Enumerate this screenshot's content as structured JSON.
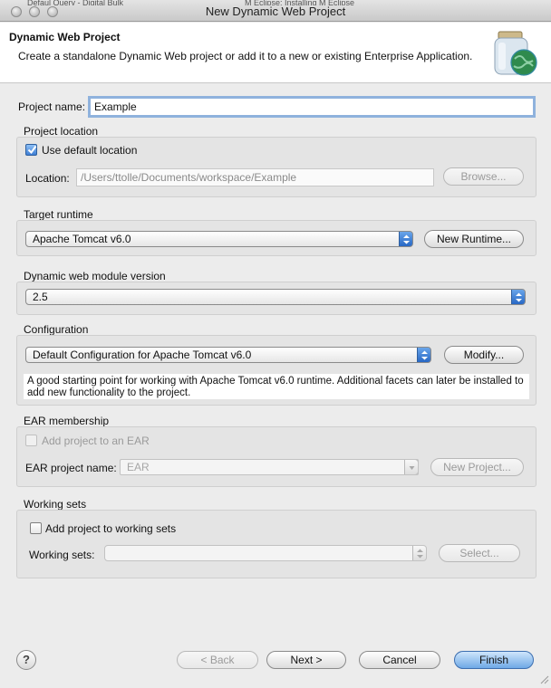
{
  "background_tabs": [
    "Defaul Query - Digital Bulk",
    "M Eclipse: Installing M Eclipse"
  ],
  "window": {
    "title": "New Dynamic Web Project"
  },
  "header": {
    "title": "Dynamic Web Project",
    "description": "Create a standalone Dynamic Web project or add it to a new or existing Enterprise Application.",
    "icon": "web-project-jar-globe-icon"
  },
  "project_name": {
    "label": "Project name:",
    "value": "Example"
  },
  "project_location": {
    "group_label": "Project location",
    "use_default_label": "Use default location",
    "use_default_checked": true,
    "location_label": "Location:",
    "location_value": "/Users/ttolle/Documents/workspace/Example",
    "browse_label": "Browse..."
  },
  "target_runtime": {
    "group_label": "Target runtime",
    "selected": "Apache Tomcat v6.0",
    "new_runtime_label": "New Runtime..."
  },
  "module_version": {
    "group_label": "Dynamic web module version",
    "selected": "2.5"
  },
  "configuration": {
    "group_label": "Configuration",
    "selected": "Default Configuration for Apache Tomcat v6.0",
    "modify_label": "Modify...",
    "description": "A good starting point for working with Apache Tomcat v6.0 runtime. Additional facets can later be installed to add new functionality to the project."
  },
  "ear_membership": {
    "group_label": "EAR membership",
    "add_label": "Add project to an EAR",
    "add_checked": false,
    "ear_name_label": "EAR project name:",
    "ear_name_value": "EAR",
    "new_project_label": "New Project..."
  },
  "working_sets": {
    "group_label": "Working sets",
    "add_label": "Add project to working sets",
    "add_checked": false,
    "sets_label": "Working sets:",
    "sets_value": "",
    "select_label": "Select..."
  },
  "footer": {
    "help_symbol": "?",
    "back_label": "< Back",
    "next_label": "Next >",
    "cancel_label": "Cancel",
    "finish_label": "Finish"
  },
  "colors": {
    "accent": "#3f7fd5",
    "default_button": "#6fa9e6",
    "window_bg": "#ececec"
  }
}
